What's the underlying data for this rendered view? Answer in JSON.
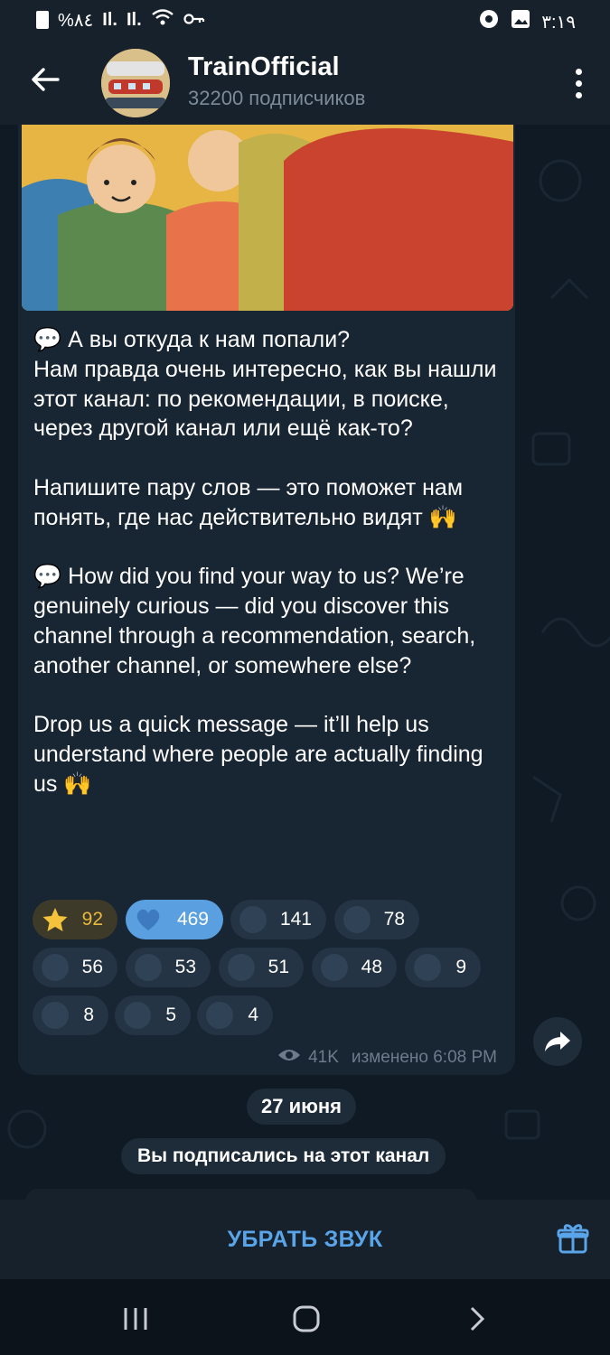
{
  "status_bar": {
    "battery": "%٨٤",
    "signal_1": "Il.",
    "signal_2": "Il.",
    "time": "٣:١٩"
  },
  "header": {
    "title": "TrainOfficial",
    "subtitle": "32200 подписчиков"
  },
  "message": {
    "paragraphs": [
      "💬 А вы откуда к нам попали?\nНам правда очень интересно, как вы нашли этот канал: по рекомендации, в поиске, через другой канал или ещё как-то?",
      "Напишите пару слов — это поможет нам понять, где нас действительно видят 🙌",
      "💬 How did you find your way to us? We’re genuinely curious — did you discover this channel through a recommendation, search, another channel, or somewhere else?",
      "Drop us a quick message — it’ll help us understand where people are actually finding us 🙌"
    ],
    "reactions": [
      {
        "icon": "star-icon",
        "count": "92"
      },
      {
        "icon": "heart-icon",
        "count": "469"
      },
      {
        "icon": "thumbs-up-icon",
        "count": "141"
      },
      {
        "icon": "fire-icon",
        "count": "78"
      },
      {
        "icon": "reaction-icon",
        "count": "56"
      },
      {
        "icon": "reaction-icon",
        "count": "53"
      },
      {
        "icon": "reaction-icon",
        "count": "51"
      },
      {
        "icon": "reaction-icon",
        "count": "48"
      },
      {
        "icon": "reaction-icon",
        "count": "9"
      },
      {
        "icon": "reaction-icon",
        "count": "8"
      },
      {
        "icon": "reaction-icon",
        "count": "5"
      },
      {
        "icon": "reaction-icon",
        "count": "4"
      }
    ],
    "views": "41K",
    "edited_time": "изменено 6:08 PM"
  },
  "date_label": "27 июня",
  "service_message": "Вы подписались на этот канал",
  "bottom": {
    "mute_label": "УБРАТЬ ЗВУК"
  },
  "colors": {
    "accent": "#5aa4ea",
    "bubble": "#182533",
    "header": "#17212b",
    "active_reaction": "#5a9fe0"
  }
}
